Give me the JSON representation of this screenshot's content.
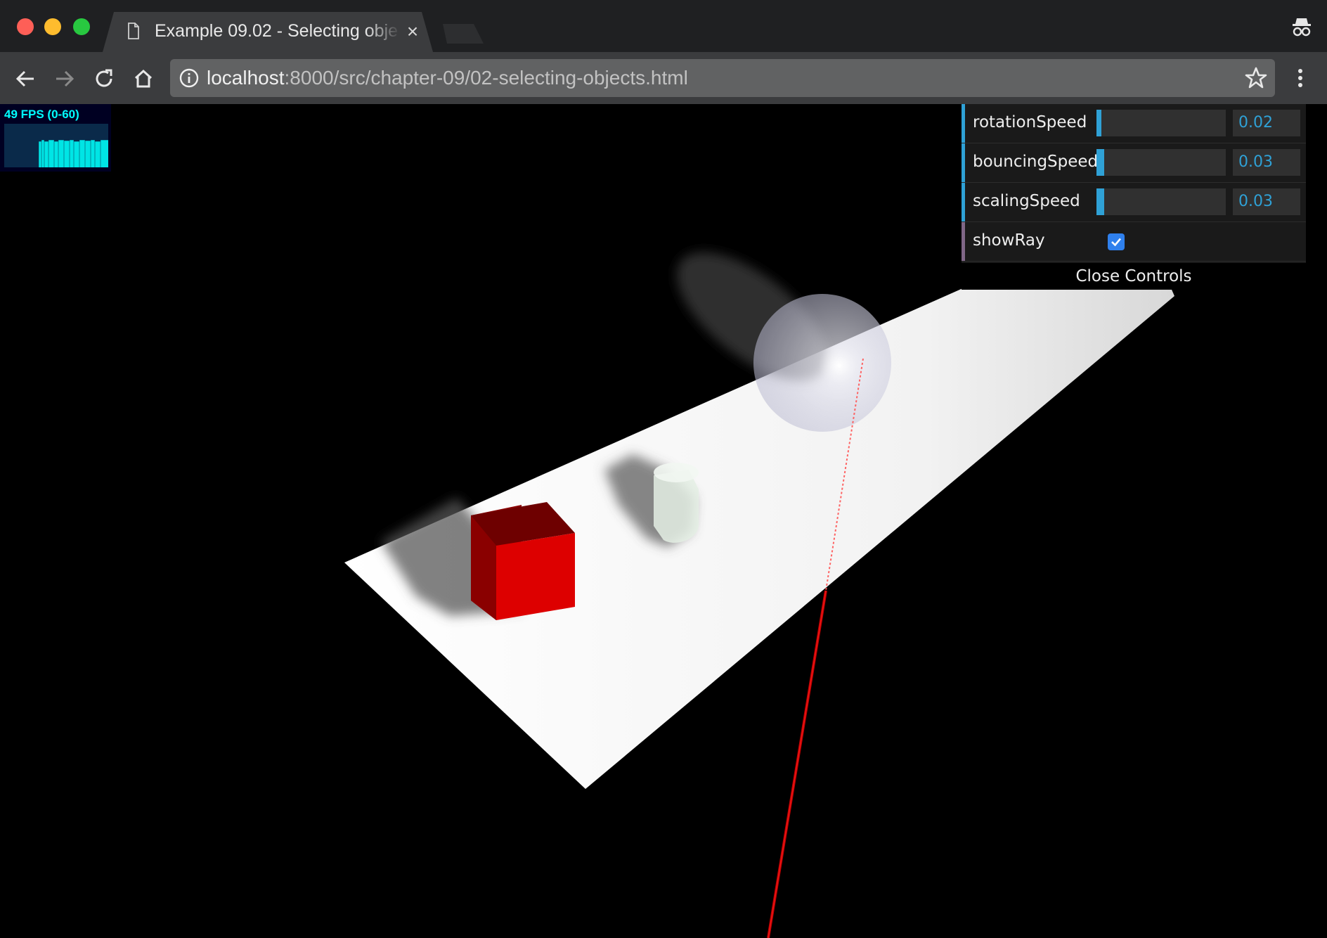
{
  "browser": {
    "tab": {
      "title": "Example 09.02 - Selecting objects",
      "icon": "document-icon"
    },
    "address": {
      "host": "localhost",
      "rest": ":8000/src/chapter-09/02-selecting-objects.html"
    },
    "icons": {
      "back": "back-arrow-icon",
      "forward": "forward-arrow-icon",
      "reload": "reload-icon",
      "home": "home-icon",
      "info": "info-icon",
      "bookmark": "star-icon",
      "menu": "kebab-menu-icon",
      "incognito": "incognito-icon"
    }
  },
  "stats": {
    "label": "49 FPS (0-60)"
  },
  "controls": {
    "rows": [
      {
        "label": "rotationSpeed",
        "value": "0.02",
        "fraction": 0.04
      },
      {
        "label": "bouncingSpeed",
        "value": "0.03",
        "fraction": 0.06
      },
      {
        "label": "scalingSpeed",
        "value": "0.03",
        "fraction": 0.06
      }
    ],
    "showRay": {
      "label": "showRay",
      "checked": true
    },
    "close_label": "Close Controls"
  },
  "colors": {
    "accent": "#2fa1d6",
    "boolean_accent": "#806787",
    "cube": "#dd0000",
    "ray": "#ff2020",
    "fps": "#00ffff"
  }
}
